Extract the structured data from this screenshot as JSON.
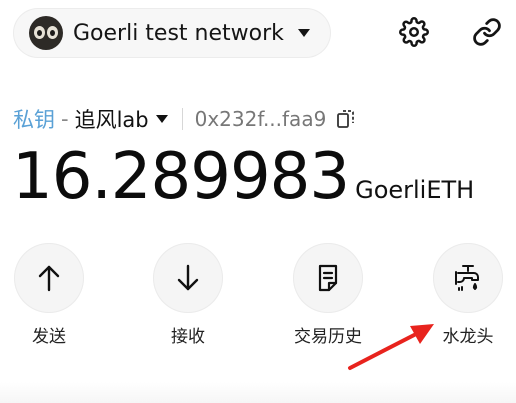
{
  "header": {
    "network": {
      "name": "Goerli test network",
      "icon": "network-avatar-icon"
    },
    "settings_icon": "gear-icon",
    "connect_icon": "link-icon"
  },
  "account": {
    "type_label": "私钥",
    "separator": "-",
    "name": "追风lab",
    "address": "0x232f...faa9",
    "copy_icon": "copy-icon"
  },
  "balance": {
    "amount": "16.289983",
    "unit": "GoerliETH"
  },
  "actions": [
    {
      "label": "发送",
      "icon": "arrow-up-icon"
    },
    {
      "label": "接收",
      "icon": "arrow-down-icon"
    },
    {
      "label": "交易历史",
      "icon": "document-icon"
    },
    {
      "label": "水龙头",
      "icon": "faucet-icon"
    }
  ],
  "colors": {
    "account_type": "#5aa1d6",
    "annotation_arrow": "#e8231d",
    "button_bg": "#f5f5f5"
  }
}
